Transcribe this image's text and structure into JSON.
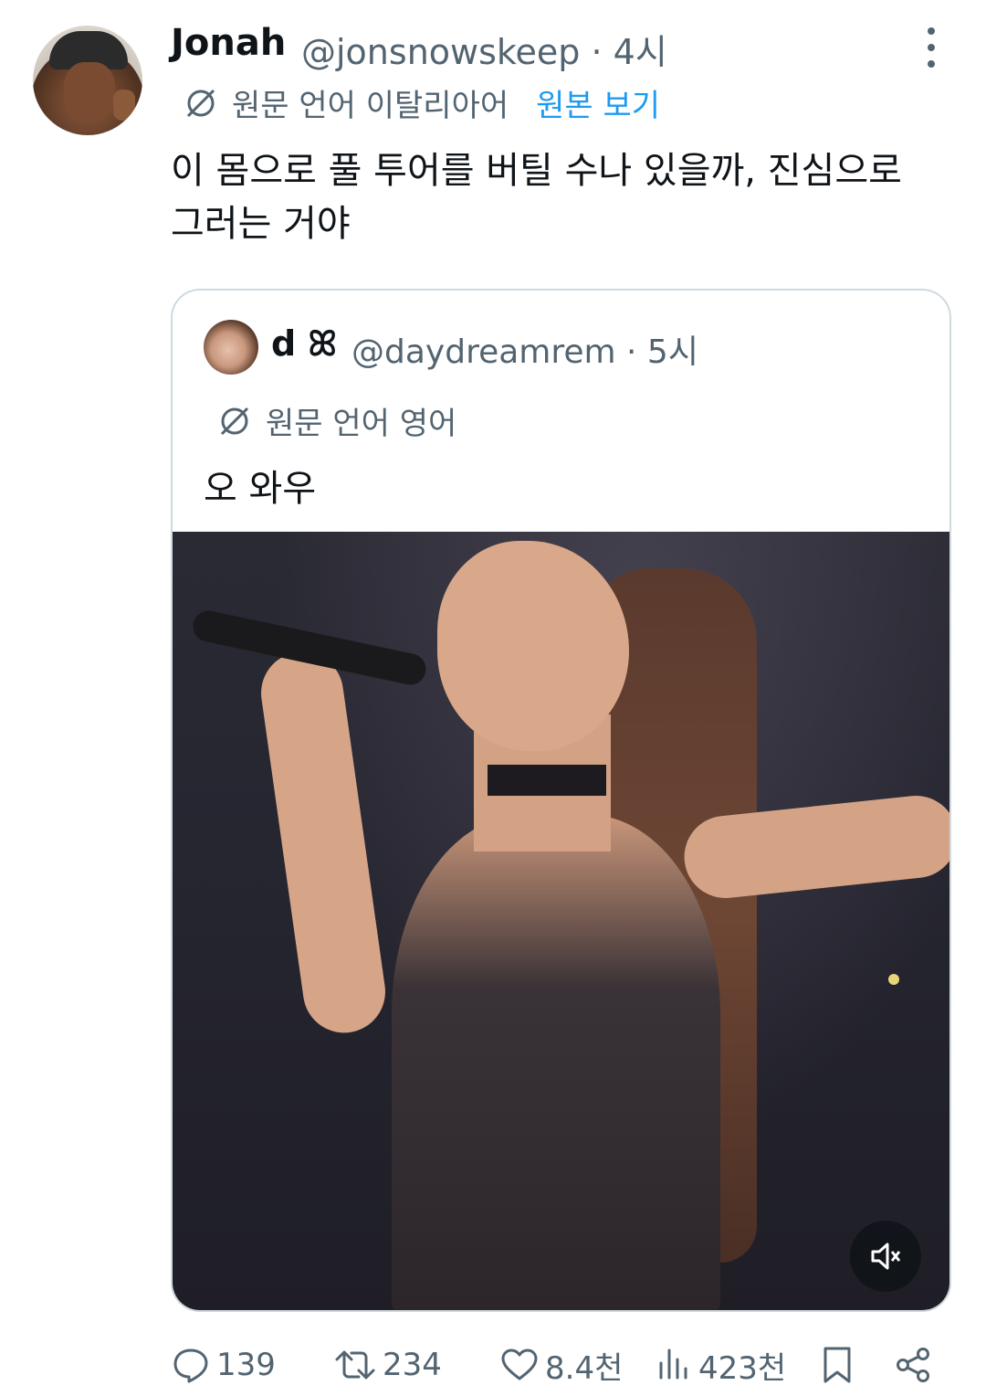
{
  "post": {
    "author_name": "Jonah",
    "handle_time": "@jonsnowskeep · 4시",
    "translation_note": "원문 언어 이탈리아어",
    "show_original": "원본 보기",
    "text": "이 몸으로 풀 투어를 버틸 수나 있을까, 진심으로 그러는 거야"
  },
  "quoted": {
    "author_name": "d ꕤ",
    "handle_time": "@daydreamrem · 5시",
    "translation_note": "원문 언어 영어",
    "text": "오 와우"
  },
  "media": {
    "mute_icon": "mute-icon"
  },
  "actions": {
    "replies": "139",
    "reposts": "234",
    "likes": "8.4천",
    "views": "423천"
  },
  "colors": {
    "text": "#0f1419",
    "secondary": "#536471",
    "link": "#1d9bf0",
    "border": "#cfd9de"
  }
}
